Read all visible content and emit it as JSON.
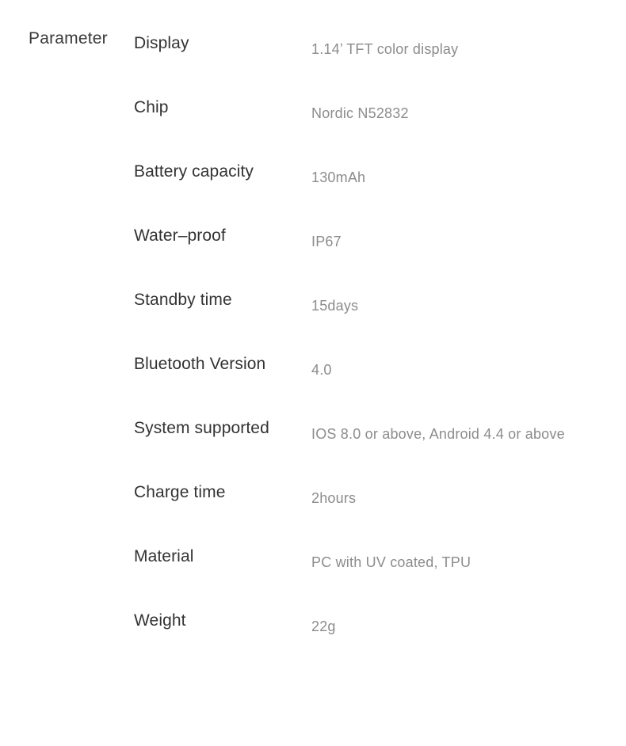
{
  "section": {
    "caption": "Parameter"
  },
  "table": {
    "rows": [
      {
        "label": "Display",
        "value": "1.14’ TFT color display"
      },
      {
        "label": "Chip",
        "value": "Nordic N52832"
      },
      {
        "label": "Battery capacity",
        "value": "130mAh"
      },
      {
        "label": "Water–proof",
        "value": "IP67"
      },
      {
        "label": "Standby time",
        "value": "15days"
      },
      {
        "label": "Bluetooth Version",
        "value": "4.0"
      },
      {
        "label": "System supported",
        "value": "IOS 8.0 or above, Android 4.4 or above"
      },
      {
        "label": "Charge time",
        "value": "2hours"
      },
      {
        "label": "Material",
        "value": "PC with UV coated, TPU"
      },
      {
        "label": "Weight",
        "value": "22g"
      }
    ]
  },
  "colors": {
    "background": "#ffffff",
    "label_text": "#333333",
    "value_text": "#8c8c8c",
    "caption_text": "#3a3a3a"
  }
}
